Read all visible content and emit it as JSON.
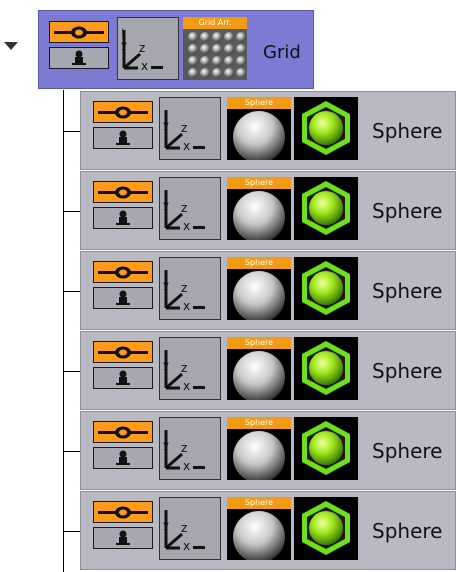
{
  "tree": {
    "parent": {
      "label": "Grid",
      "thumbnail_tag": "Grid Arr.",
      "icons": [
        "visibility-eye-icon",
        "lock-person-icon",
        "axis-xyz-icon",
        "grid-array-icon",
        "collapse-arrow-icon"
      ]
    },
    "children": [
      {
        "label": "Sphere",
        "thumbnail_tag": "Sphere"
      },
      {
        "label": "Sphere",
        "thumbnail_tag": "Sphere"
      },
      {
        "label": "Sphere",
        "thumbnail_tag": "Sphere"
      },
      {
        "label": "Sphere",
        "thumbnail_tag": "Sphere"
      },
      {
        "label": "Sphere",
        "thumbnail_tag": "Sphere"
      },
      {
        "label": "Sphere",
        "thumbnail_tag": "Sphere"
      }
    ],
    "child_icons": [
      "visibility-eye-icon",
      "lock-person-icon",
      "axis-xyz-icon",
      "sphere-icon",
      "material-hexagon-icon"
    ]
  },
  "colors": {
    "parent_bg": "#7c7bd3",
    "child_bg": "#b9b9c3",
    "accent_orange": "#ff9a1a",
    "material_green": "#6ee01a"
  }
}
